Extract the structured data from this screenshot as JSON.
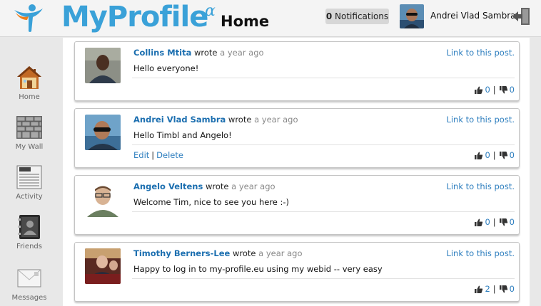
{
  "app": {
    "brand": "MyProfile",
    "brand_sup": "α",
    "page_title": "Home"
  },
  "header": {
    "notifications_count": "0",
    "notifications_label": "Notifications",
    "user_name": "Andrei Vlad Sambra"
  },
  "sidebar": {
    "items": [
      {
        "label": "Home",
        "icon": "home-icon"
      },
      {
        "label": "My Wall",
        "icon": "wall-icon"
      },
      {
        "label": "Activity",
        "icon": "news-icon"
      },
      {
        "label": "Friends",
        "icon": "address-book-icon"
      },
      {
        "label": "Messages",
        "icon": "envelope-icon"
      }
    ]
  },
  "posts": [
    {
      "author": "Collins Mtita",
      "wrote": "wrote",
      "time": "a year ago",
      "link": "Link to this post.",
      "text": "Hello everyone!",
      "edit": "",
      "delete": "",
      "likes": "0",
      "dislikes": "0"
    },
    {
      "author": "Andrei Vlad Sambra",
      "wrote": "wrote",
      "time": "a year ago",
      "link": "Link to this post.",
      "text": "Hello Timbl and Angelo!",
      "edit": "Edit",
      "delete": "Delete",
      "likes": "0",
      "dislikes": "0"
    },
    {
      "author": "Angelo Veltens",
      "wrote": "wrote",
      "time": "a year ago",
      "link": "Link to this post.",
      "text": "Welcome Tim, nice to see you here :-)",
      "edit": "",
      "delete": "",
      "likes": "0",
      "dislikes": "0"
    },
    {
      "author": "Timothy Berners-Lee",
      "wrote": "wrote",
      "time": "a year ago",
      "link": "Link to this post.",
      "text": "Happy to log in to my-profile.eu using my webid -- very easy",
      "edit": "",
      "delete": "",
      "likes": "2",
      "dislikes": "0"
    }
  ],
  "colors": {
    "brand": "#3aa1d8",
    "link": "#2f7fbf",
    "author": "#1c6fb0"
  }
}
